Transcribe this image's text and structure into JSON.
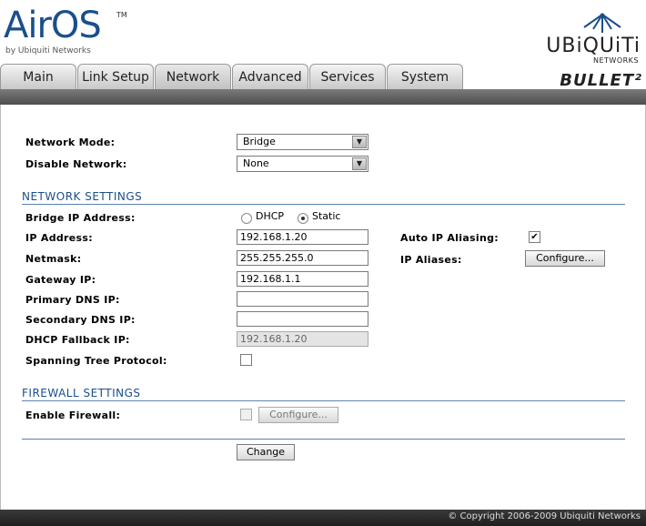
{
  "logo": {
    "brand": "AirOS",
    "tm": "TM",
    "sub": "by Ubiquiti Networks"
  },
  "vendor": {
    "name": "UBiQUiTi",
    "networks": "NETWORKS"
  },
  "product": "BULLET²",
  "tabs": [
    {
      "label": "Main"
    },
    {
      "label": "Link Setup"
    },
    {
      "label": "Network"
    },
    {
      "label": "Advanced"
    },
    {
      "label": "Services"
    },
    {
      "label": "System"
    }
  ],
  "form": {
    "network_mode": {
      "label": "Network Mode:",
      "value": "Bridge"
    },
    "disable_network": {
      "label": "Disable Network:",
      "value": "None"
    },
    "network_settings_title": "NETWORK SETTINGS",
    "bridge_ip": {
      "label": "Bridge IP Address:",
      "dhcp": "DHCP",
      "static": "Static"
    },
    "ip_address": {
      "label": "IP Address:",
      "value": "192.168.1.20"
    },
    "netmask": {
      "label": "Netmask:",
      "value": "255.255.255.0"
    },
    "gateway": {
      "label": "Gateway IP:",
      "value": "192.168.1.1"
    },
    "primary_dns": {
      "label": "Primary DNS IP:",
      "value": ""
    },
    "secondary_dns": {
      "label": "Secondary DNS IP:",
      "value": ""
    },
    "dhcp_fallback": {
      "label": "DHCP Fallback IP:",
      "value": "192.168.1.20"
    },
    "stp": {
      "label": "Spanning Tree Protocol:"
    },
    "auto_alias": {
      "label": "Auto IP Aliasing:",
      "check": "✔"
    },
    "ip_aliases": {
      "label": "IP Aliases:",
      "button": "Configure..."
    },
    "firewall_settings_title": "FIREWALL SETTINGS",
    "enable_firewall": {
      "label": "Enable Firewall:",
      "button": "Configure..."
    },
    "change_button": "Change"
  },
  "footer": "© Copyright 2006-2009 Ubiquiti Networks",
  "colors": {
    "accent": "#1a4f8c",
    "rule": "#5b83b0",
    "footer_bg": "#2a2a2a"
  }
}
